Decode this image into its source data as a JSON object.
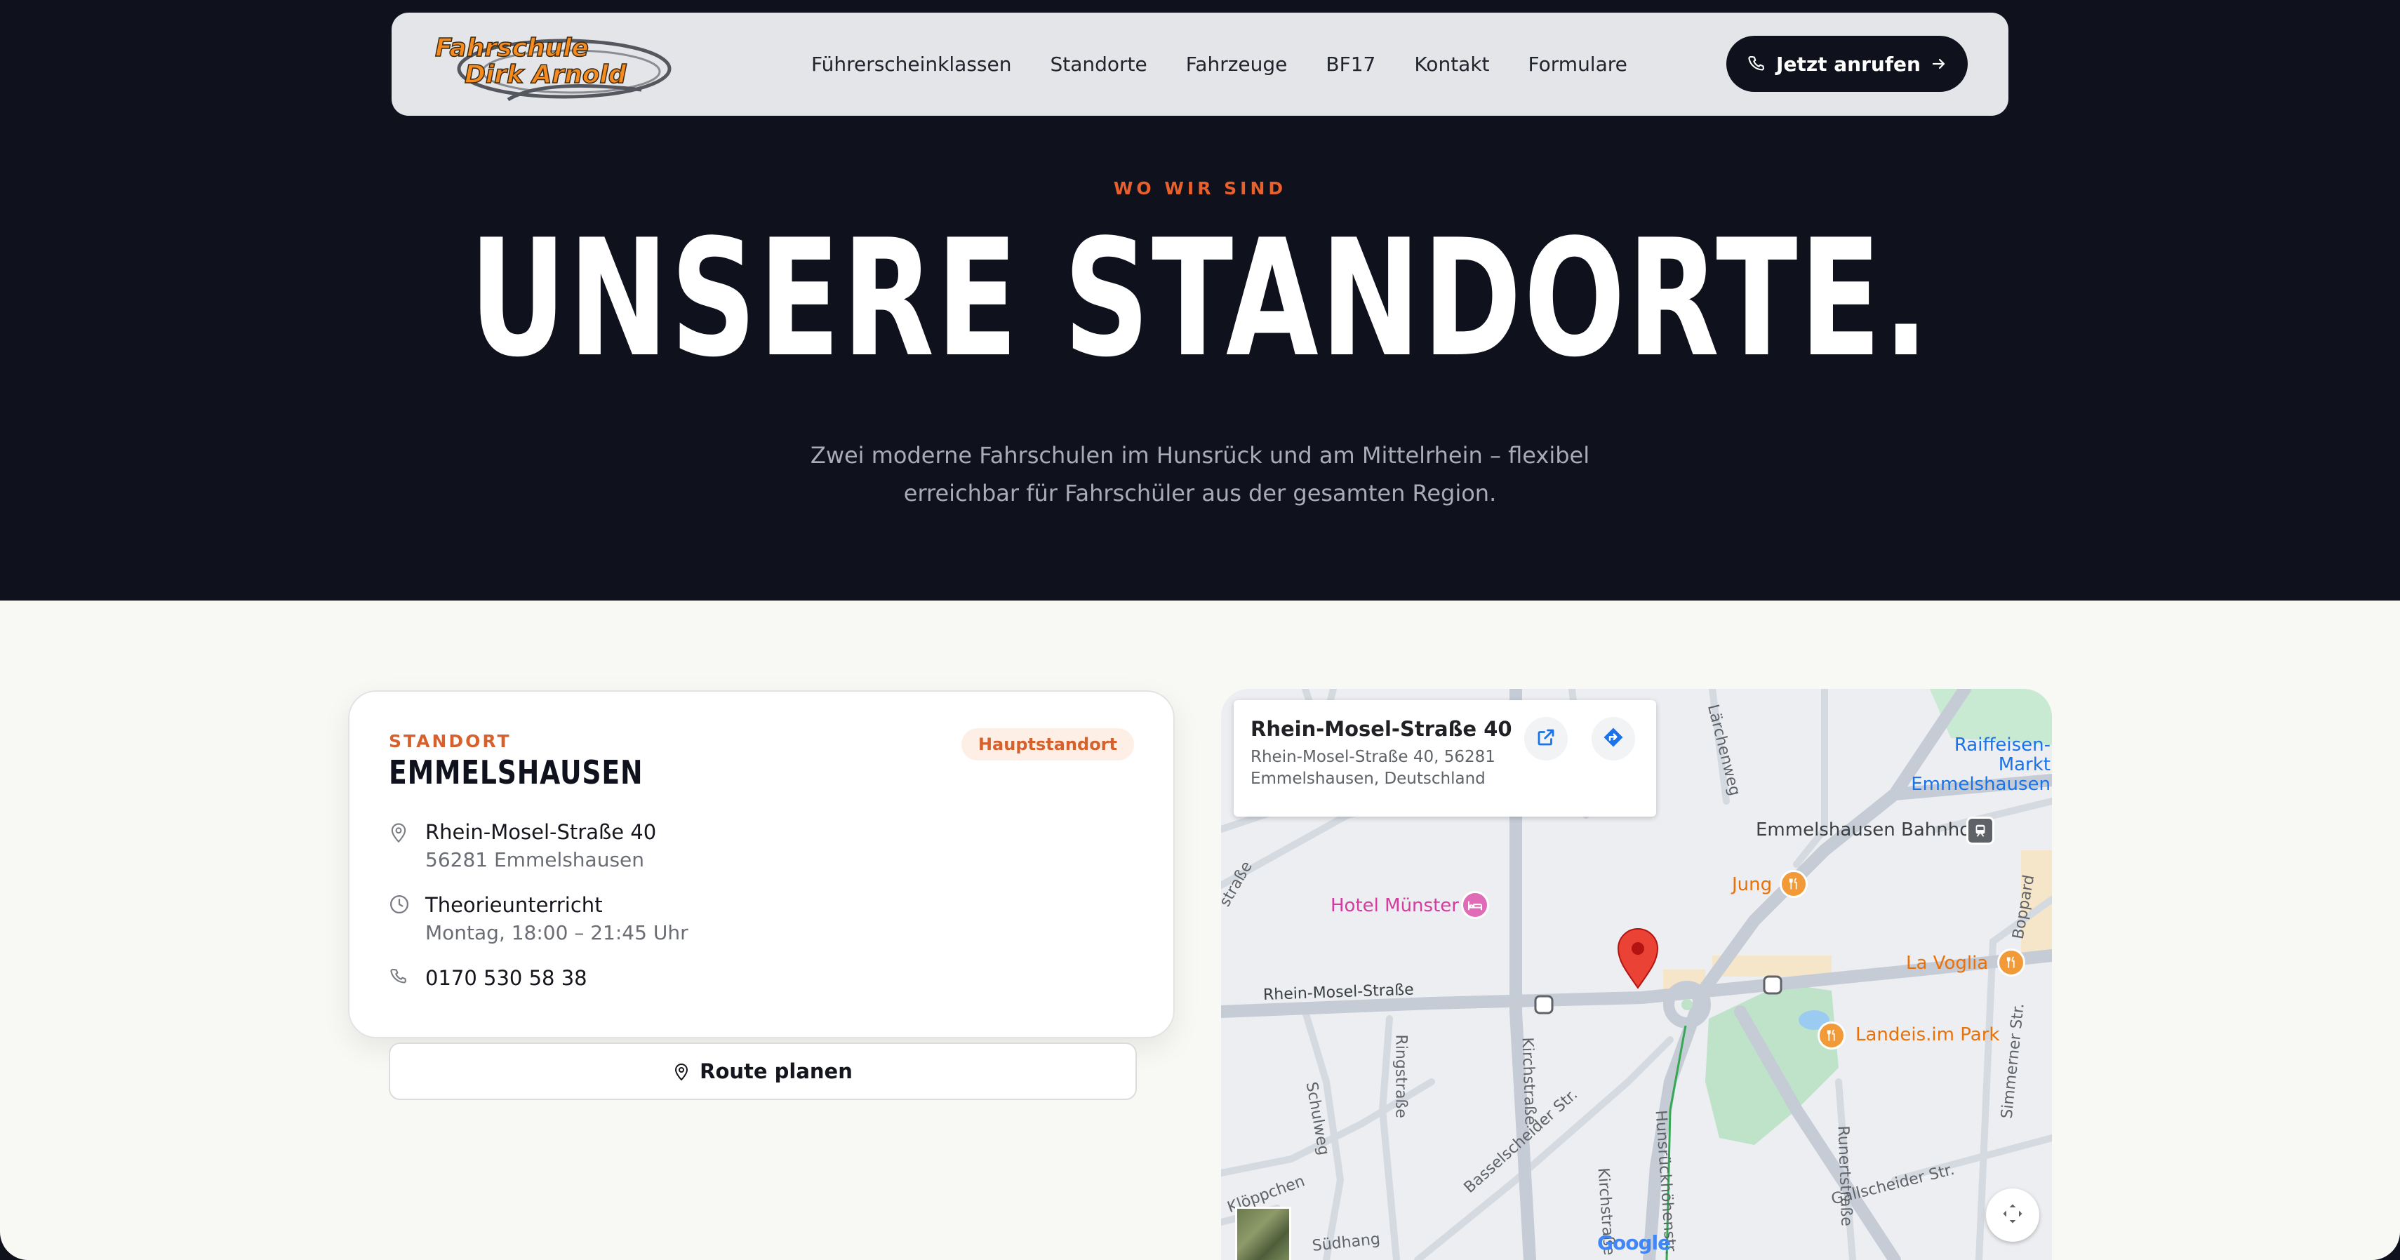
{
  "nav": {
    "logo_line1": "Fahrschule",
    "logo_line2": "Dirk Arnold",
    "links": [
      "Führerscheinklassen",
      "Standorte",
      "Fahrzeuge",
      "BF17",
      "Kontakt",
      "Formulare"
    ],
    "call_label": "Jetzt anrufen"
  },
  "hero": {
    "eyebrow": "WO WIR SIND",
    "title": "UNSERE STANDORTE.",
    "subtitle": "Zwei moderne Fahrschulen im Hunsrück und am Mittelrhein – flexibel erreichbar für Fahrschüler aus der gesamten Region."
  },
  "location": {
    "label": "STANDORT",
    "name": "EMMELSHAUSEN",
    "badge": "Hauptstandort",
    "street": "Rhein-Mosel-Straße 40",
    "city": "56281 Emmelshausen",
    "lesson_title": "Theorieunterricht",
    "lesson_time": "Montag, 18:00 – 21:45 Uhr",
    "phone": "0170 530 58 38",
    "route_label": "Route planen"
  },
  "map": {
    "info_title": "Rhein-Mosel-Straße 40",
    "info_address": "Rhein-Mosel-Straße 40, 56281 Emmelshausen, Deutschland",
    "pois": {
      "raiffeisen": "Raiffeisen-Markt Emmelshausen",
      "bahnhof": "Emmelshausen Bahnhof",
      "jung": "Jung",
      "hotel": "Hotel Münster",
      "lavoglia": "La Voglia",
      "landeis": "Landeis.im Park"
    },
    "streets": {
      "rhein_mosel": "Rhein-Mosel-Straße",
      "ringstrasse": "Ringstraße",
      "kirchstrasse1": "Kirchstraße",
      "kirchstrasse2": "Kirchstraße",
      "schulweg": "Schulweg",
      "basselscheider": "Basselscheider Str.",
      "hunsrueck": "Hunsrückhöhenstr.",
      "runertstrasse": "Runertstraße",
      "gallscheider": "Gallscheider Str.",
      "simmerner": "Simmerner Str.",
      "boppard": "Boppard",
      "laerchenweg": "Lärchenweg",
      "kloeppchen": "Klöppchen",
      "suedhang": "Südhang",
      "strasse": "straße"
    },
    "google": "Google",
    "colors": {
      "pin": "#ea4335",
      "water": "#9ccbf1",
      "park": "#bfe3c9",
      "road": "#c5ccd6"
    }
  },
  "colors": {
    "accent": "#e8612c",
    "dark": "#0f111c"
  }
}
